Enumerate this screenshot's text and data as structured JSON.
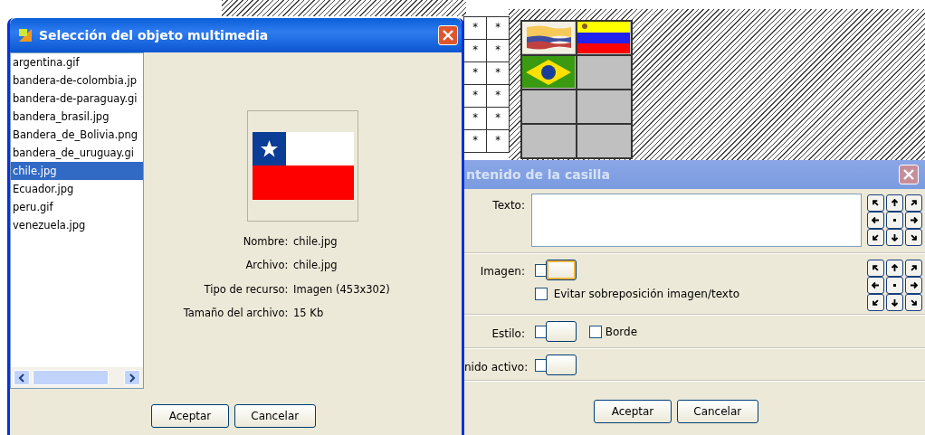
{
  "background": {
    "star_grid": [
      [
        "*",
        "*"
      ],
      [
        "*",
        "*"
      ],
      [
        "*",
        "*"
      ],
      [
        "*",
        "*"
      ],
      [
        "*",
        "*"
      ],
      [
        "*",
        "*"
      ]
    ],
    "board": [
      {
        "kind": "wavy_stripes"
      },
      {
        "kind": "stripes"
      },
      {
        "kind": "diamond"
      },
      {
        "kind": "empty"
      },
      {
        "kind": "empty"
      },
      {
        "kind": "empty"
      },
      {
        "kind": "empty"
      },
      {
        "kind": "empty"
      }
    ]
  },
  "media_dialog": {
    "title": "Selección del objeto multimedia",
    "files": [
      {
        "name": "argentina.gif",
        "selected": false
      },
      {
        "name": "bandera-de-colombia.jp",
        "selected": false
      },
      {
        "name": "bandera-de-paraguay.gi",
        "selected": false
      },
      {
        "name": "bandera_brasil.jpg",
        "selected": false
      },
      {
        "name": "Bandera_de_Bolivia.png",
        "selected": false
      },
      {
        "name": "bandera_de_uruguay.gi",
        "selected": false
      },
      {
        "name": "chile.jpg",
        "selected": true
      },
      {
        "name": "Ecuador.jpg",
        "selected": false
      },
      {
        "name": "peru.gif",
        "selected": false
      },
      {
        "name": "venezuela.jpg",
        "selected": false
      }
    ],
    "details": [
      {
        "label": "Nombre:",
        "value": "chile.jpg"
      },
      {
        "label": "Archivo:",
        "value": "chile.jpg"
      },
      {
        "label": "Tipo de recurso:",
        "value": "Imagen (453x302)"
      },
      {
        "label": "Tamaño del archivo:",
        "value": "15 Kb"
      }
    ],
    "buttons": [
      "Aceptar",
      "Cancelar"
    ]
  },
  "cell_dialog": {
    "title": "ntenido de la casilla",
    "active": false,
    "rows": [
      {
        "kind": "text",
        "label": "Texto:"
      },
      {
        "label": "Imagen:",
        "checked": false,
        "focused": true,
        "option": {
          "label": "Evitar sobreposición imagen/texto",
          "checked": false
        }
      },
      {
        "kind": "style",
        "label": "Estilo:",
        "checked": false,
        "focused": false,
        "option": {
          "label": "Borde",
          "checked": false
        }
      },
      {
        "kind": "plain",
        "label": "nido activo:",
        "checked": false,
        "focused": false
      }
    ],
    "buttons": [
      "Aceptar",
      "Cancelar"
    ]
  }
}
